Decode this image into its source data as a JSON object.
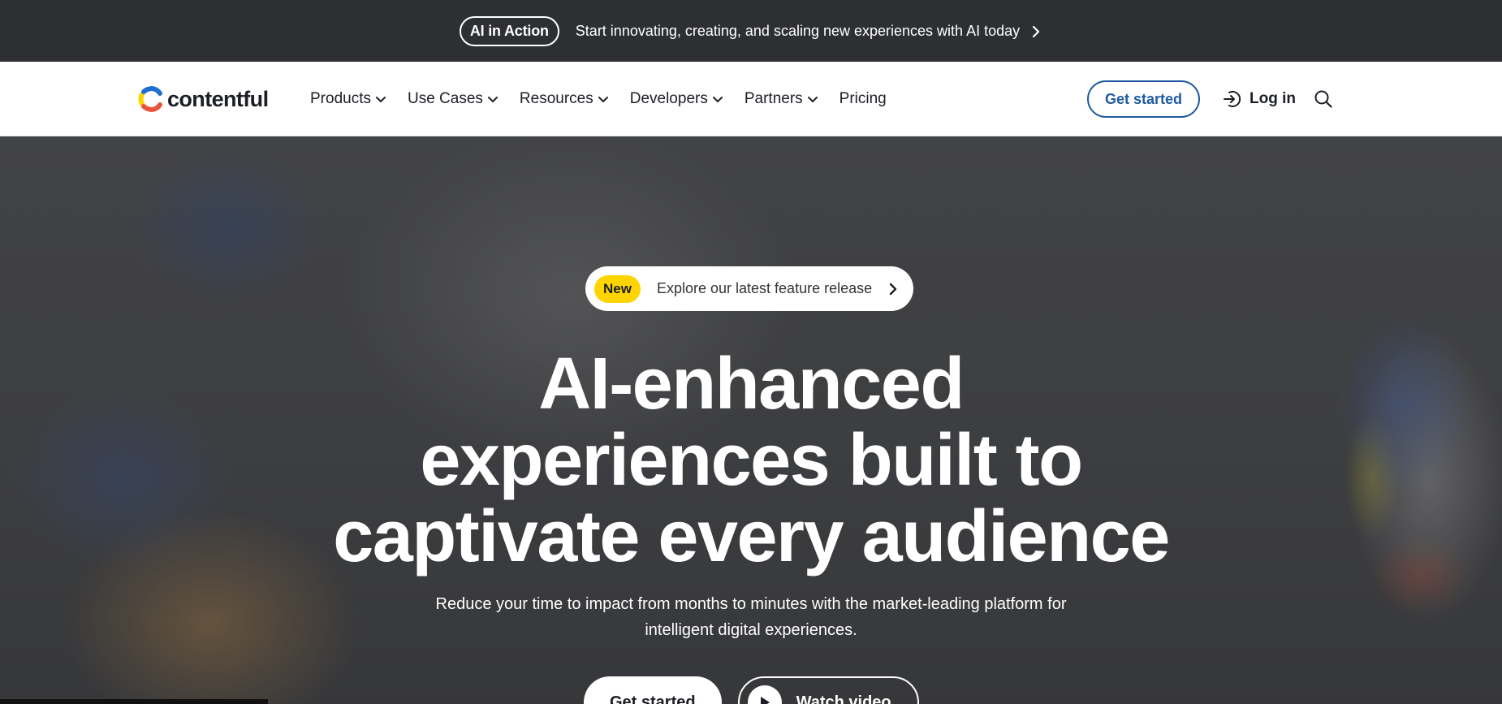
{
  "announcement": {
    "pill": "AI in Action",
    "message": "Start innovating, creating, and scaling new experiences with AI today",
    "icon": "chevron-right-icon"
  },
  "nav": {
    "logo_text": "contentful",
    "items": [
      {
        "label": "Products",
        "dropdown": true
      },
      {
        "label": "Use Cases",
        "dropdown": true
      },
      {
        "label": "Resources",
        "dropdown": true
      },
      {
        "label": "Developers",
        "dropdown": true
      },
      {
        "label": "Partners",
        "dropdown": true
      },
      {
        "label": "Pricing",
        "dropdown": false
      }
    ],
    "get_started": "Get started",
    "login": "Log in",
    "icons": [
      "login-icon",
      "search-icon"
    ]
  },
  "hero": {
    "badge": "New",
    "release_text": "Explore our latest feature release",
    "headline": [
      "AI-enhanced",
      "experiences built to",
      "captivate every audience"
    ],
    "subhead": "Reduce your time to impact from months to minutes with the market-leading platform for intelligent digital experiences.",
    "cta_primary": "Get started",
    "cta_secondary": "Watch video"
  },
  "colors": {
    "announcement_bg": "#2d2f33",
    "nav_bg": "#ffffff",
    "accent_blue": "#1f5aa0",
    "badge_yellow": "#ffd400",
    "text_dark": "#1c1f26"
  }
}
